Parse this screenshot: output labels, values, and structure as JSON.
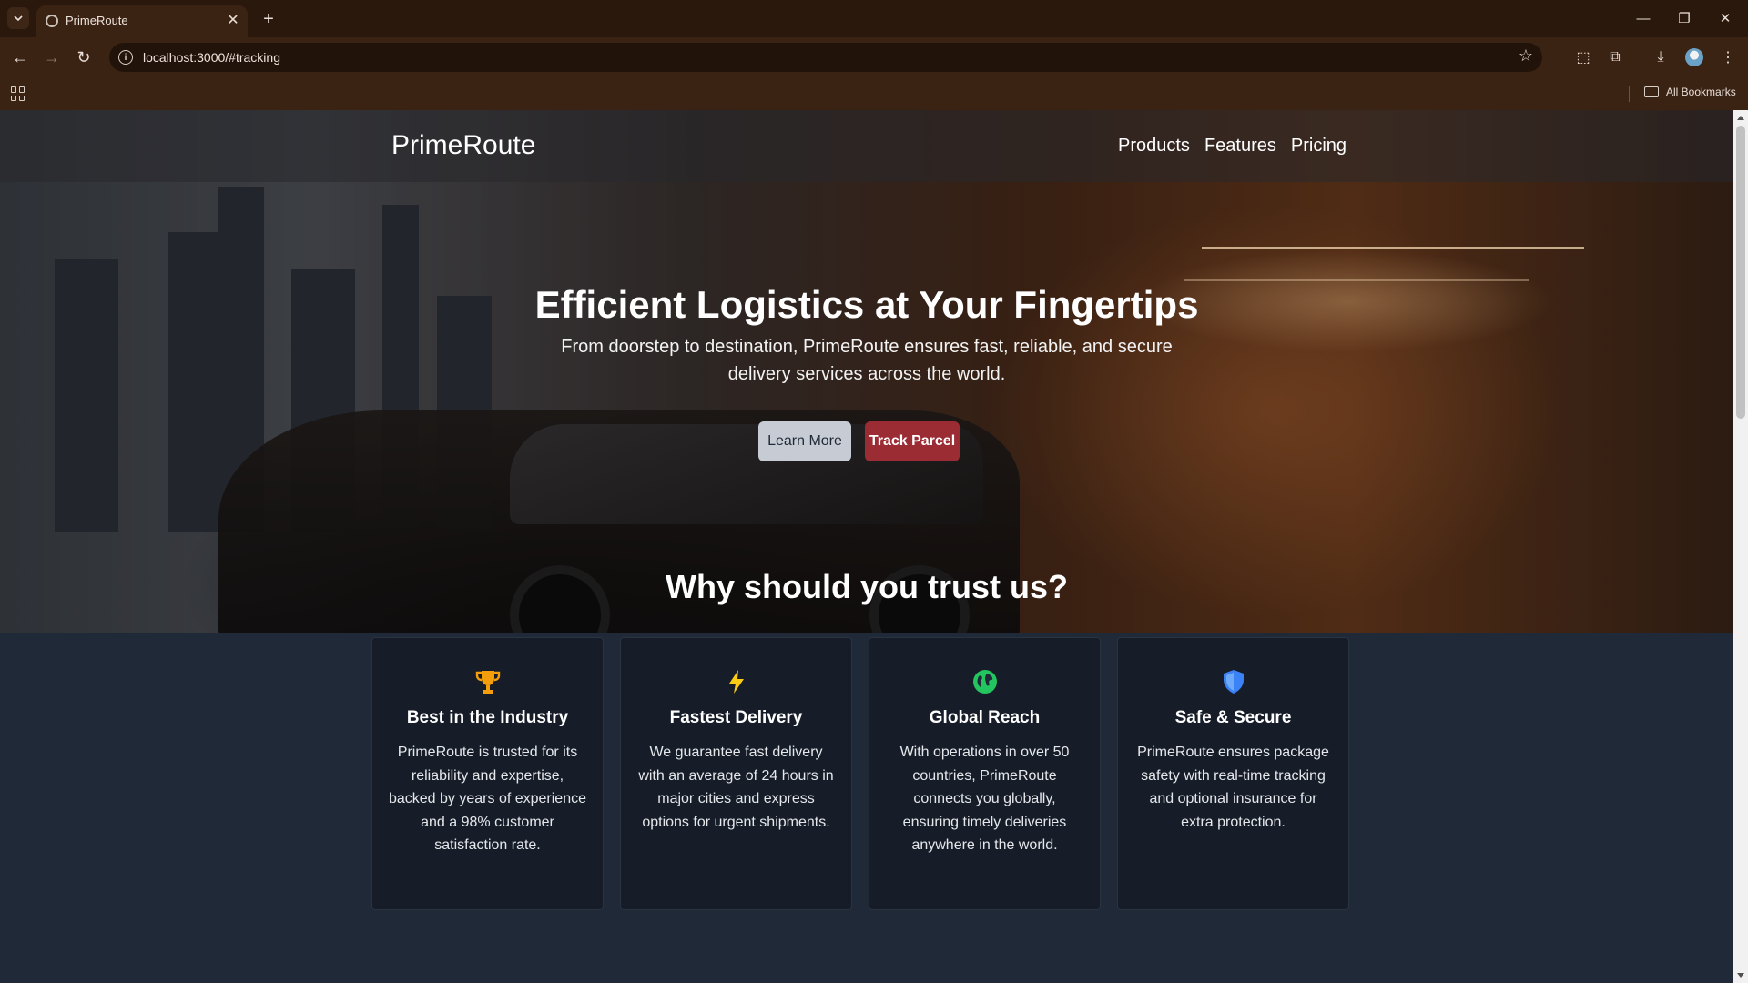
{
  "browser": {
    "tab_title": "PrimeRoute",
    "url": "localhost:3000/#tracking",
    "bookmarks_label": "All Bookmarks"
  },
  "site": {
    "brand": "PrimeRoute",
    "nav": [
      "Products",
      "Features",
      "Pricing"
    ]
  },
  "hero": {
    "title": "Efficient Logistics at Your Fingertips",
    "subtitle": "From doorstep to destination, PrimeRoute ensures fast, reliable, and secure delivery services across the world.",
    "learn_more": "Learn More",
    "track_parcel": "Track Parcel"
  },
  "trust": {
    "title": "Why should you trust us?",
    "cards": [
      {
        "icon": "trophy-icon",
        "color": "#f59e0b",
        "title": "Best in the Industry",
        "text": "PrimeRoute is trusted for its reliability and expertise, backed by years of experience and a 98% customer satisfaction rate."
      },
      {
        "icon": "lightning-icon",
        "color": "#facc15",
        "title": "Fastest Delivery",
        "text": "We guarantee fast delivery with an average of 24 hours in major cities and express options for urgent shipments."
      },
      {
        "icon": "globe-icon",
        "color": "#22c55e",
        "title": "Global Reach",
        "text": "With operations in over 50 countries, PrimeRoute connects you globally, ensuring timely deliveries anywhere in the world."
      },
      {
        "icon": "shield-icon",
        "color": "#3b82f6",
        "title": "Safe & Secure",
        "text": "PrimeRoute ensures package safety with real-time tracking and optional insurance for extra protection."
      }
    ]
  },
  "colors": {
    "track_button": "#9b2c34",
    "learn_button": "#c7ccd4",
    "page_background": "#1f2937"
  }
}
